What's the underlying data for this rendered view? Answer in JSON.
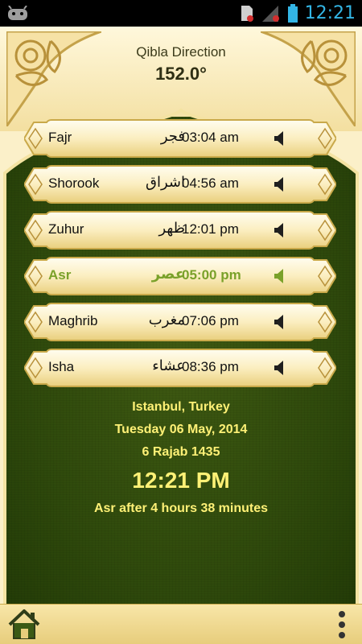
{
  "status_bar": {
    "time": "12:21"
  },
  "qibla": {
    "label": "Qibla Direction",
    "value": "152.0°"
  },
  "prayers": [
    {
      "name": "Fajr",
      "arabic": "فجر",
      "time": "03:04 am",
      "active": false
    },
    {
      "name": "Shorook",
      "arabic": "اشراق",
      "time": "04:56 am",
      "active": false
    },
    {
      "name": "Zuhur",
      "arabic": "ظهر",
      "time": "12:01 pm",
      "active": false
    },
    {
      "name": "Asr",
      "arabic": "عصر",
      "time": "05:00 pm",
      "active": true
    },
    {
      "name": "Maghrib",
      "arabic": "مغرب",
      "time": "07:06 pm",
      "active": false
    },
    {
      "name": "Isha",
      "arabic": "عشاء",
      "time": "08:36 pm",
      "active": false
    }
  ],
  "info": {
    "location": "Istanbul, Turkey",
    "date": "Tuesday 06 May, 2014",
    "hijri": "6 Rajab 1435",
    "clock": "12:21 PM",
    "next_prayer": "Asr after 4  hours 38 minutes"
  },
  "colors": {
    "accent_active": "#7aa12a",
    "info_text": "#fff176",
    "background_green": "#2f4a0c",
    "status_time": "#33b5e5"
  },
  "icons": {
    "status_left": "android-icon",
    "status_right": [
      "sd-card-icon",
      "signal-icon",
      "battery-icon"
    ],
    "row": "speaker-icon",
    "bottom_left": "home-icon",
    "bottom_right": "overflow-menu-icon"
  }
}
